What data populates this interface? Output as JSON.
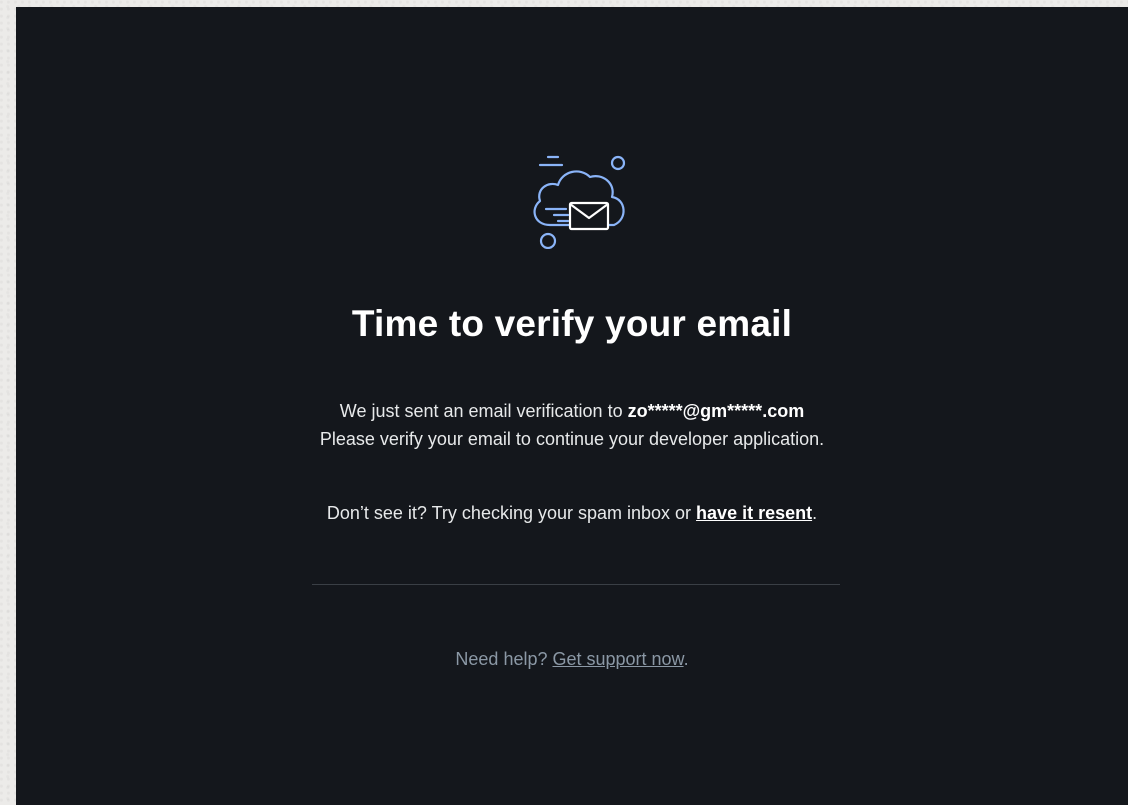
{
  "illustration": {
    "icon": "cloud-envelope-icon",
    "stroke_color": "#8ab4f8",
    "envelope_color": "#ffffff"
  },
  "title": "Time to verify your email",
  "message": {
    "sent_prefix": "We just sent an email verification to ",
    "email": "zo*****@gm*****.com",
    "instruction": "Please verify your email to continue your developer application.",
    "spam_prefix": "Don’t see it? Try checking your spam inbox or ",
    "resend_link": "have it resent",
    "spam_suffix": "."
  },
  "help": {
    "prefix": "Need help? ",
    "support_link": "Get support now",
    "suffix": "."
  },
  "colors": {
    "background": "#14171c",
    "text": "#e7e9ea",
    "muted": "#8b98a5",
    "divider": "#3a3f45"
  }
}
